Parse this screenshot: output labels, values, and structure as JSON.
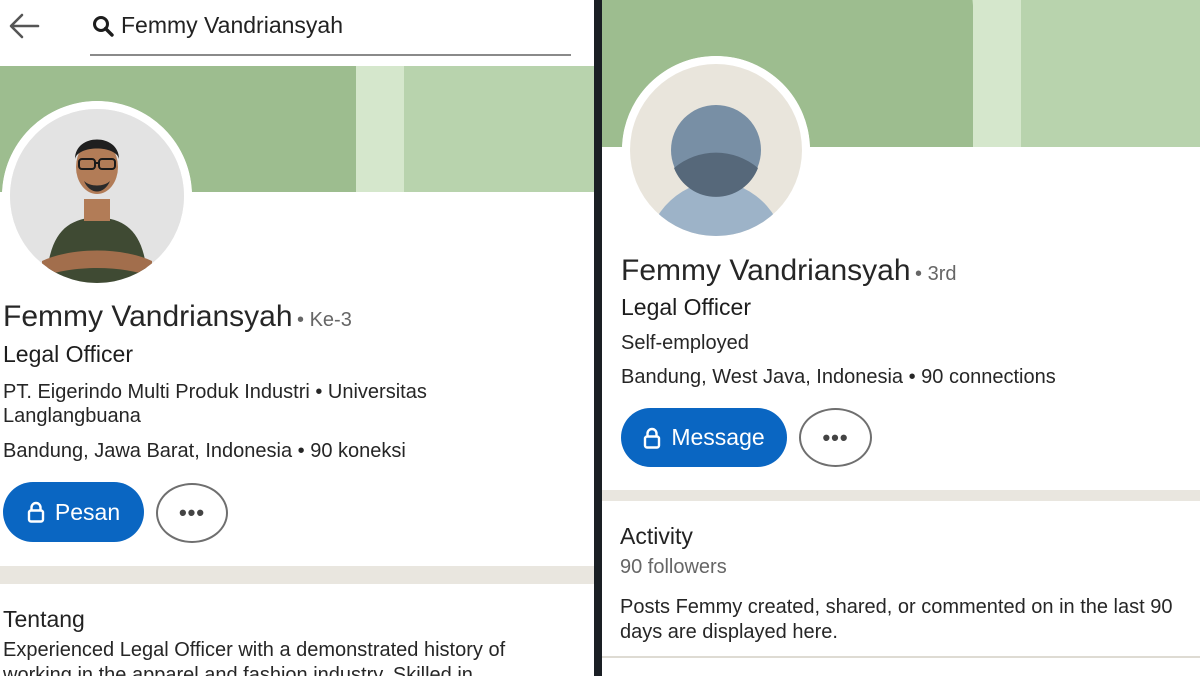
{
  "left": {
    "search": {
      "query": "Femmy Vandriansyah"
    },
    "profile": {
      "name": "Femmy Vandriansyah",
      "degree": "• Ke-3",
      "headline": "Legal Officer",
      "company_school": "PT. Eigerindo Multi Produk Industri • Universitas Langlangbuana",
      "location": "Bandung, Jawa Barat, Indonesia • 90 koneksi"
    },
    "actions": {
      "message_label": "Pesan",
      "more_label": "•••"
    },
    "about": {
      "title": "Tentang",
      "text": "Experienced Legal Officer with a demonstrated history of working in the apparel and fashion industry. Skilled in"
    }
  },
  "right": {
    "profile": {
      "name": "Femmy Vandriansyah",
      "degree": "• 3rd",
      "headline": "Legal Officer",
      "company": "Self-employed",
      "location": "Bandung, West Java, Indonesia • 90 connections"
    },
    "actions": {
      "message_label": "Message",
      "more_label": "•••"
    },
    "activity": {
      "title": "Activity",
      "followers": "90 followers",
      "text": "Posts Femmy created, shared, or commented on in the last 90 days are displayed here."
    }
  },
  "colors": {
    "brand_blue": "#0a66c2",
    "cover_dark": "#9dbd8f",
    "cover_light": "#b8d3ad",
    "cover_stripe": "#d5e7cc",
    "divider": "#e9e6df"
  },
  "icons": [
    "back-arrow-icon",
    "search-icon",
    "lock-icon",
    "more-dots-icon",
    "profile-photo",
    "default-avatar-icon"
  ]
}
